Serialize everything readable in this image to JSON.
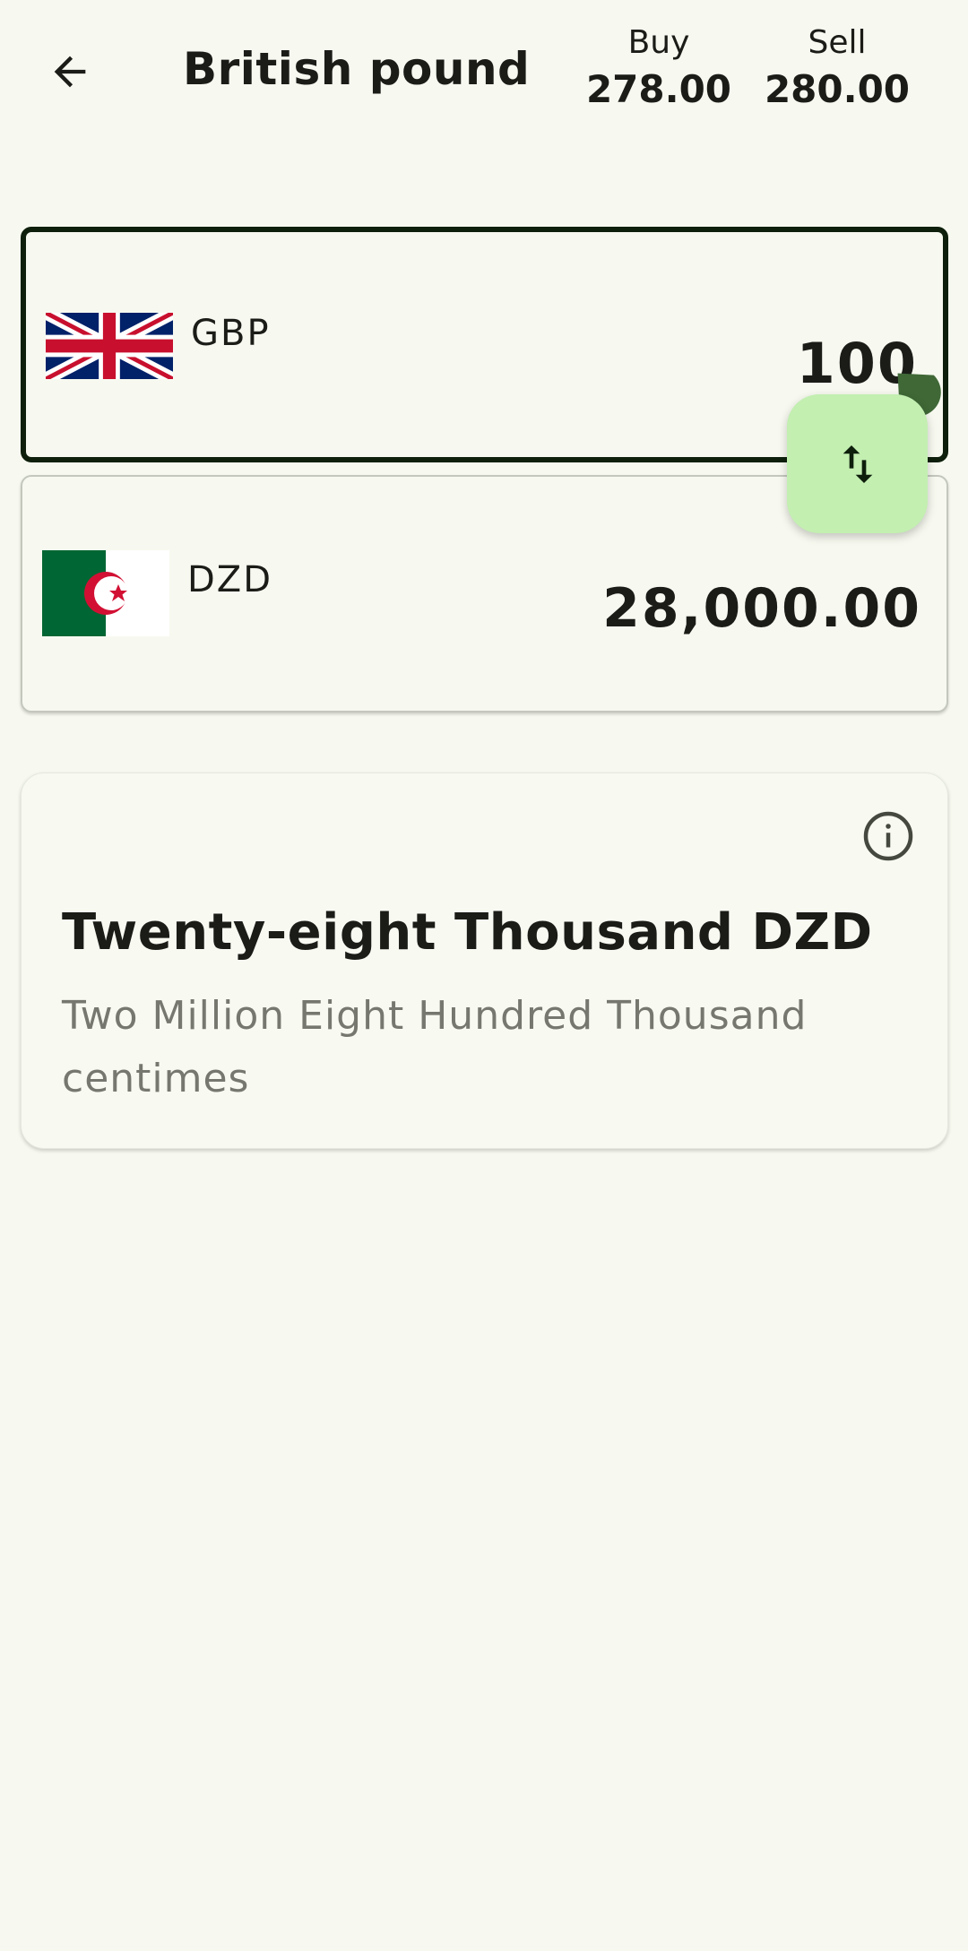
{
  "header": {
    "title": "British pound",
    "buy_label": "Buy",
    "buy_value": "278.00",
    "sell_label": "Sell",
    "sell_value": "280.00"
  },
  "from_currency": {
    "code": "GBP",
    "amount": "100",
    "flag_icon": "uk-flag-icon"
  },
  "to_currency": {
    "code": "DZD",
    "amount": "28,000.00",
    "flag_icon": "algeria-flag-icon"
  },
  "amount_in_words": {
    "main": "Twenty-eight Thousand DZD",
    "sub": "Two Million Eight Hundred Thousand centimes"
  },
  "colors": {
    "background": "#f7f9f0",
    "selected_border": "#0e1f0c",
    "swap_button": "#c3efb1",
    "cursor_handle": "#3f6836",
    "secondary_text": "#76786f"
  }
}
